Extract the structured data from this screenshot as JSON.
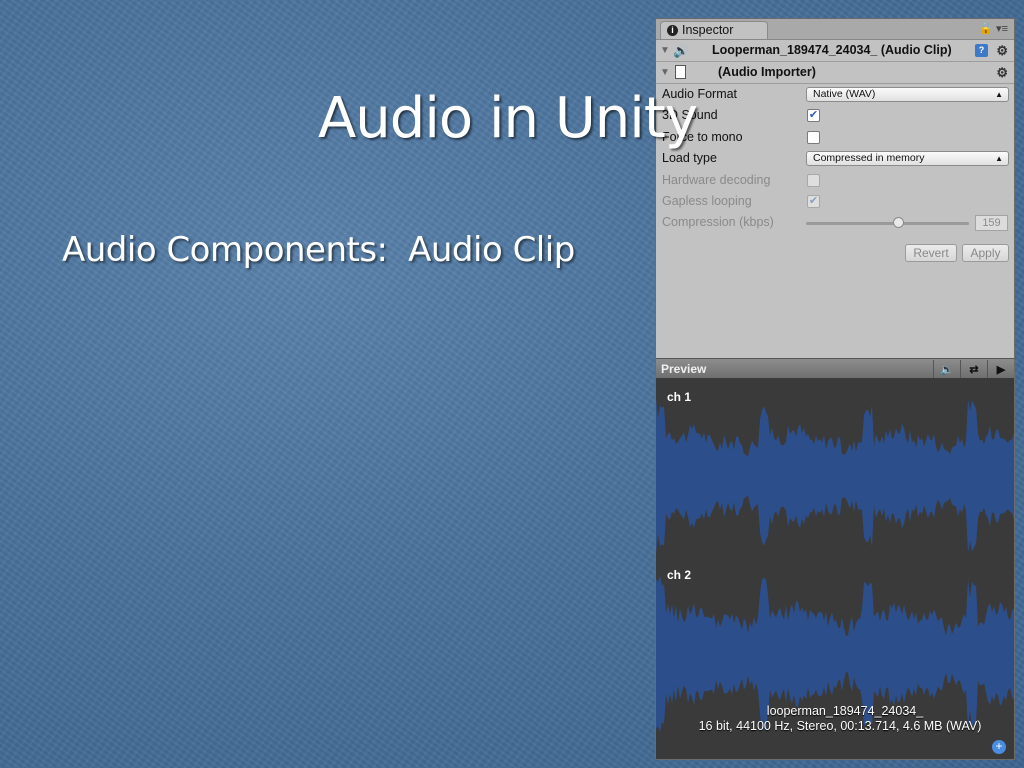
{
  "slide": {
    "title": "Audio in Unity",
    "bullet": "Audio Components:  Audio Clip"
  },
  "inspector": {
    "tab_label": "Inspector",
    "tab_controls": "🔒 ▾≡",
    "clip_header": "Looperman_189474_24034_ (Audio Clip)",
    "importer_header": "(Audio Importer)",
    "properties": [
      {
        "label": "Audio Format",
        "type": "dropdown",
        "value": "Native (WAV)"
      },
      {
        "label": "3D Sound",
        "type": "checkbox",
        "checked": true
      },
      {
        "label": "Force to mono",
        "type": "checkbox",
        "checked": false
      },
      {
        "label": "Load type",
        "type": "dropdown",
        "value": "Compressed in memory"
      },
      {
        "label": "Hardware decoding",
        "type": "checkbox",
        "checked": false,
        "disabled": true
      },
      {
        "label": "Gapless looping",
        "type": "checkbox",
        "checked": true,
        "disabled": true
      },
      {
        "label": "Compression (kbps)",
        "type": "slider",
        "value": "159",
        "disabled": true
      }
    ],
    "revert_label": "Revert",
    "apply_label": "Apply",
    "preview": {
      "label": "Preview",
      "channel1": "ch 1",
      "channel2": "ch 2",
      "clip_name": "looperman_189474_24034_",
      "clip_details": "16 bit, 44100 Hz, Stereo, 00:13.714, 4.6 MB (WAV)"
    }
  },
  "colors": {
    "waveform": "#2c4f8c",
    "preview_bg": "#3a3a3a",
    "slide_bg": "#4a729c"
  }
}
